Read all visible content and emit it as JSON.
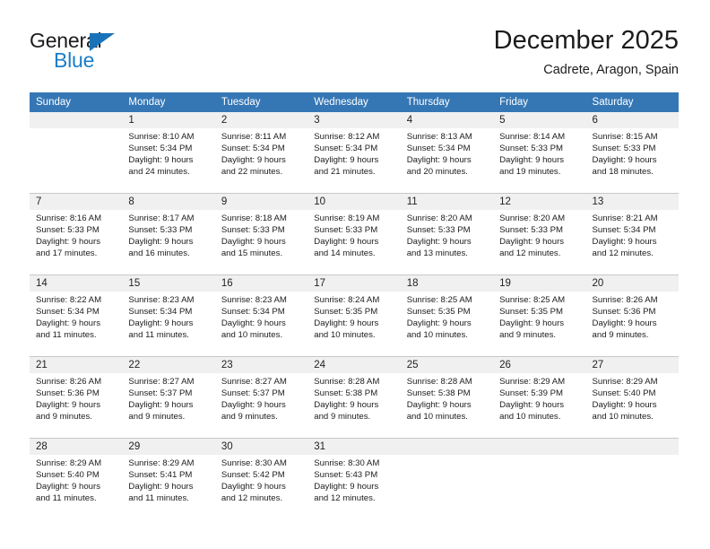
{
  "brand": {
    "name_top": "General",
    "name_bottom": "Blue",
    "triangle_color": "#1a73b8",
    "blue_color": "#1a7ec8"
  },
  "header": {
    "month_title": "December 2025",
    "location": "Cadrete, Aragon, Spain"
  },
  "theme": {
    "header_blue": "#3577b5",
    "daynum_band": "#f0f0f0",
    "grid_line": "#c8c8c8",
    "text": "#1c1c1c"
  },
  "weekdays": [
    "Sunday",
    "Monday",
    "Tuesday",
    "Wednesday",
    "Thursday",
    "Friday",
    "Saturday"
  ],
  "weeks": [
    [
      {
        "day": "",
        "sunrise": "",
        "sunset": "",
        "daylight1": "",
        "daylight2": ""
      },
      {
        "day": "1",
        "sunrise": "Sunrise: 8:10 AM",
        "sunset": "Sunset: 5:34 PM",
        "daylight1": "Daylight: 9 hours",
        "daylight2": "and 24 minutes."
      },
      {
        "day": "2",
        "sunrise": "Sunrise: 8:11 AM",
        "sunset": "Sunset: 5:34 PM",
        "daylight1": "Daylight: 9 hours",
        "daylight2": "and 22 minutes."
      },
      {
        "day": "3",
        "sunrise": "Sunrise: 8:12 AM",
        "sunset": "Sunset: 5:34 PM",
        "daylight1": "Daylight: 9 hours",
        "daylight2": "and 21 minutes."
      },
      {
        "day": "4",
        "sunrise": "Sunrise: 8:13 AM",
        "sunset": "Sunset: 5:34 PM",
        "daylight1": "Daylight: 9 hours",
        "daylight2": "and 20 minutes."
      },
      {
        "day": "5",
        "sunrise": "Sunrise: 8:14 AM",
        "sunset": "Sunset: 5:33 PM",
        "daylight1": "Daylight: 9 hours",
        "daylight2": "and 19 minutes."
      },
      {
        "day": "6",
        "sunrise": "Sunrise: 8:15 AM",
        "sunset": "Sunset: 5:33 PM",
        "daylight1": "Daylight: 9 hours",
        "daylight2": "and 18 minutes."
      }
    ],
    [
      {
        "day": "7",
        "sunrise": "Sunrise: 8:16 AM",
        "sunset": "Sunset: 5:33 PM",
        "daylight1": "Daylight: 9 hours",
        "daylight2": "and 17 minutes."
      },
      {
        "day": "8",
        "sunrise": "Sunrise: 8:17 AM",
        "sunset": "Sunset: 5:33 PM",
        "daylight1": "Daylight: 9 hours",
        "daylight2": "and 16 minutes."
      },
      {
        "day": "9",
        "sunrise": "Sunrise: 8:18 AM",
        "sunset": "Sunset: 5:33 PM",
        "daylight1": "Daylight: 9 hours",
        "daylight2": "and 15 minutes."
      },
      {
        "day": "10",
        "sunrise": "Sunrise: 8:19 AM",
        "sunset": "Sunset: 5:33 PM",
        "daylight1": "Daylight: 9 hours",
        "daylight2": "and 14 minutes."
      },
      {
        "day": "11",
        "sunrise": "Sunrise: 8:20 AM",
        "sunset": "Sunset: 5:33 PM",
        "daylight1": "Daylight: 9 hours",
        "daylight2": "and 13 minutes."
      },
      {
        "day": "12",
        "sunrise": "Sunrise: 8:20 AM",
        "sunset": "Sunset: 5:33 PM",
        "daylight1": "Daylight: 9 hours",
        "daylight2": "and 12 minutes."
      },
      {
        "day": "13",
        "sunrise": "Sunrise: 8:21 AM",
        "sunset": "Sunset: 5:34 PM",
        "daylight1": "Daylight: 9 hours",
        "daylight2": "and 12 minutes."
      }
    ],
    [
      {
        "day": "14",
        "sunrise": "Sunrise: 8:22 AM",
        "sunset": "Sunset: 5:34 PM",
        "daylight1": "Daylight: 9 hours",
        "daylight2": "and 11 minutes."
      },
      {
        "day": "15",
        "sunrise": "Sunrise: 8:23 AM",
        "sunset": "Sunset: 5:34 PM",
        "daylight1": "Daylight: 9 hours",
        "daylight2": "and 11 minutes."
      },
      {
        "day": "16",
        "sunrise": "Sunrise: 8:23 AM",
        "sunset": "Sunset: 5:34 PM",
        "daylight1": "Daylight: 9 hours",
        "daylight2": "and 10 minutes."
      },
      {
        "day": "17",
        "sunrise": "Sunrise: 8:24 AM",
        "sunset": "Sunset: 5:35 PM",
        "daylight1": "Daylight: 9 hours",
        "daylight2": "and 10 minutes."
      },
      {
        "day": "18",
        "sunrise": "Sunrise: 8:25 AM",
        "sunset": "Sunset: 5:35 PM",
        "daylight1": "Daylight: 9 hours",
        "daylight2": "and 10 minutes."
      },
      {
        "day": "19",
        "sunrise": "Sunrise: 8:25 AM",
        "sunset": "Sunset: 5:35 PM",
        "daylight1": "Daylight: 9 hours",
        "daylight2": "and 9 minutes."
      },
      {
        "day": "20",
        "sunrise": "Sunrise: 8:26 AM",
        "sunset": "Sunset: 5:36 PM",
        "daylight1": "Daylight: 9 hours",
        "daylight2": "and 9 minutes."
      }
    ],
    [
      {
        "day": "21",
        "sunrise": "Sunrise: 8:26 AM",
        "sunset": "Sunset: 5:36 PM",
        "daylight1": "Daylight: 9 hours",
        "daylight2": "and 9 minutes."
      },
      {
        "day": "22",
        "sunrise": "Sunrise: 8:27 AM",
        "sunset": "Sunset: 5:37 PM",
        "daylight1": "Daylight: 9 hours",
        "daylight2": "and 9 minutes."
      },
      {
        "day": "23",
        "sunrise": "Sunrise: 8:27 AM",
        "sunset": "Sunset: 5:37 PM",
        "daylight1": "Daylight: 9 hours",
        "daylight2": "and 9 minutes."
      },
      {
        "day": "24",
        "sunrise": "Sunrise: 8:28 AM",
        "sunset": "Sunset: 5:38 PM",
        "daylight1": "Daylight: 9 hours",
        "daylight2": "and 9 minutes."
      },
      {
        "day": "25",
        "sunrise": "Sunrise: 8:28 AM",
        "sunset": "Sunset: 5:38 PM",
        "daylight1": "Daylight: 9 hours",
        "daylight2": "and 10 minutes."
      },
      {
        "day": "26",
        "sunrise": "Sunrise: 8:29 AM",
        "sunset": "Sunset: 5:39 PM",
        "daylight1": "Daylight: 9 hours",
        "daylight2": "and 10 minutes."
      },
      {
        "day": "27",
        "sunrise": "Sunrise: 8:29 AM",
        "sunset": "Sunset: 5:40 PM",
        "daylight1": "Daylight: 9 hours",
        "daylight2": "and 10 minutes."
      }
    ],
    [
      {
        "day": "28",
        "sunrise": "Sunrise: 8:29 AM",
        "sunset": "Sunset: 5:40 PM",
        "daylight1": "Daylight: 9 hours",
        "daylight2": "and 11 minutes."
      },
      {
        "day": "29",
        "sunrise": "Sunrise: 8:29 AM",
        "sunset": "Sunset: 5:41 PM",
        "daylight1": "Daylight: 9 hours",
        "daylight2": "and 11 minutes."
      },
      {
        "day": "30",
        "sunrise": "Sunrise: 8:30 AM",
        "sunset": "Sunset: 5:42 PM",
        "daylight1": "Daylight: 9 hours",
        "daylight2": "and 12 minutes."
      },
      {
        "day": "31",
        "sunrise": "Sunrise: 8:30 AM",
        "sunset": "Sunset: 5:43 PM",
        "daylight1": "Daylight: 9 hours",
        "daylight2": "and 12 minutes."
      },
      {
        "day": "",
        "sunrise": "",
        "sunset": "",
        "daylight1": "",
        "daylight2": ""
      },
      {
        "day": "",
        "sunrise": "",
        "sunset": "",
        "daylight1": "",
        "daylight2": ""
      },
      {
        "day": "",
        "sunrise": "",
        "sunset": "",
        "daylight1": "",
        "daylight2": ""
      }
    ]
  ]
}
